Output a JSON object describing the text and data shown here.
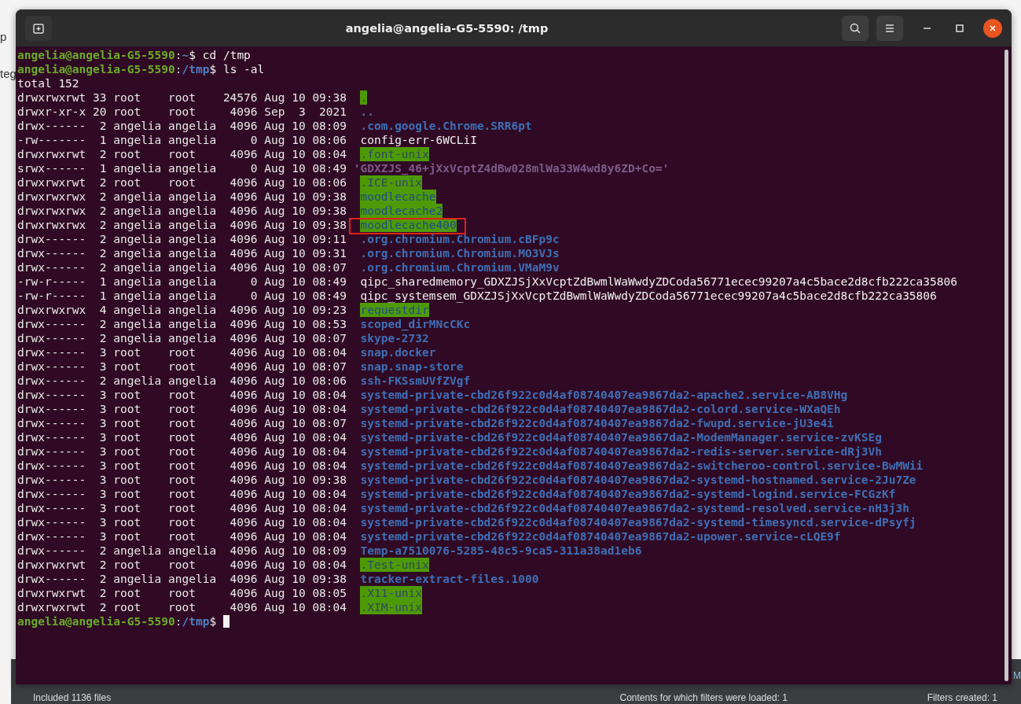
{
  "window": {
    "title": "angelia@angelia-G5-5590: /tmp"
  },
  "background": {
    "fragments": [
      "p",
      "teg"
    ],
    "status_items": [
      "Included 1136 files",
      "Contents for which filters were loaded: 1",
      "Filters created: 1"
    ],
    "edge_letter": "M"
  },
  "terminal": {
    "lines": [
      {
        "kind": "prompt",
        "user": "angelia@angelia-G5-5590",
        "sep": ":",
        "path": "~",
        "sign": "$",
        "command": " cd /tmp"
      },
      {
        "kind": "prompt",
        "user": "angelia@angelia-G5-5590",
        "sep": ":",
        "path": "/tmp",
        "sign": "$",
        "command": " ls -al"
      },
      {
        "kind": "text",
        "text": "total 152"
      },
      {
        "kind": "sticky_dir",
        "meta": "drwxrwxrwt 33 root    root    24576 Aug 10 09:38",
        "name": ".",
        "highlighted": false
      },
      {
        "kind": "dir",
        "meta": "drwxr-xr-x 20 root    root     4096 Sep  3  2021",
        "name": "..",
        "highlighted": false
      },
      {
        "kind": "dir",
        "meta": "drwx------  2 angelia angelia  4096 Aug 10 08:09",
        "name": ".com.google.Chrome.SRR6pt",
        "highlighted": false
      },
      {
        "kind": "file",
        "meta": "-rw-------  1 angelia angelia     0 Aug 10 08:06",
        "name": "config-err-6WCLiI",
        "highlighted": false
      },
      {
        "kind": "sticky_dir",
        "meta": "drwxrwxrwt  2 root    root     4096 Aug 10 08:04",
        "name": ".font-unix",
        "highlighted": false
      },
      {
        "kind": "socket",
        "meta": "srwx------  1 angelia angelia     0 Aug 10 08:49",
        "name": "'GDXZJS_46+jXxVcptZ4dBw028mlWa33W4wd8y6ZD+Co='",
        "highlighted": false
      },
      {
        "kind": "sticky_dir",
        "meta": "drwxrwxrwt  2 root    root     4096 Aug 10 08:06",
        "name": ".ICE-unix",
        "highlighted": false
      },
      {
        "kind": "writable_dir",
        "meta": "drwxrwxrwx  2 angelia angelia  4096 Aug 10 09:38",
        "name": "moodlecache",
        "highlighted": false
      },
      {
        "kind": "writable_dir",
        "meta": "drwxrwxrwx  2 angelia angelia  4096 Aug 10 09:38",
        "name": "moodlecache2",
        "highlighted": false
      },
      {
        "kind": "writable_dir",
        "meta": "drwxrwxrwx  2 angelia angelia  4096 Aug 10 09:38",
        "name": "moodlecache400",
        "highlighted": true
      },
      {
        "kind": "dir",
        "meta": "drwx------  2 angelia angelia  4096 Aug 10 09:11",
        "name": ".org.chromium.Chromium.cBFp9c",
        "highlighted": false
      },
      {
        "kind": "dir",
        "meta": "drwx------  2 angelia angelia  4096 Aug 10 09:31",
        "name": ".org.chromium.Chromium.MO3VJs",
        "highlighted": false
      },
      {
        "kind": "dir",
        "meta": "drwx------  2 angelia angelia  4096 Aug 10 08:07",
        "name": ".org.chromium.Chromium.VMaM9v",
        "highlighted": false
      },
      {
        "kind": "file",
        "meta": "-rw-r-----  1 angelia angelia     0 Aug 10 08:49",
        "name": "qipc_sharedmemory_GDXZJSjXxVcptZdBwmlWaWwdyZDCoda56771ecec99207a4c5bace2d8cfb222ca35806",
        "highlighted": false
      },
      {
        "kind": "file",
        "meta": "-rw-r-----  1 angelia angelia     0 Aug 10 08:49",
        "name": "qipc_systemsem_GDXZJSjXxVcptZdBwmlWaWwdyZDCoda56771ecec99207a4c5bace2d8cfb222ca35806",
        "highlighted": false
      },
      {
        "kind": "writable_dir",
        "meta": "drwxrwxrwx  4 angelia angelia  4096 Aug 10 09:23",
        "name": "requestdir",
        "highlighted": false
      },
      {
        "kind": "dir",
        "meta": "drwx------  2 angelia angelia  4096 Aug 10 08:53",
        "name": "scoped_dirMNcCKc",
        "highlighted": false
      },
      {
        "kind": "dir",
        "meta": "drwx------  2 angelia angelia  4096 Aug 10 08:07",
        "name": "skype-2732",
        "highlighted": false
      },
      {
        "kind": "dir",
        "meta": "drwx------  3 root    root     4096 Aug 10 08:04",
        "name": "snap.docker",
        "highlighted": false
      },
      {
        "kind": "dir",
        "meta": "drwx------  3 root    root     4096 Aug 10 08:07",
        "name": "snap.snap-store",
        "highlighted": false
      },
      {
        "kind": "dir",
        "meta": "drwx------  2 angelia angelia  4096 Aug 10 08:06",
        "name": "ssh-FKSsmUVfZVgf",
        "highlighted": false
      },
      {
        "kind": "dir",
        "meta": "drwx------  3 root    root     4096 Aug 10 08:04",
        "name": "systemd-private-cbd26f922c0d4af08740407ea9867da2-apache2.service-AB8VHg",
        "highlighted": false
      },
      {
        "kind": "dir",
        "meta": "drwx------  3 root    root     4096 Aug 10 08:04",
        "name": "systemd-private-cbd26f922c0d4af08740407ea9867da2-colord.service-WXaQEh",
        "highlighted": false
      },
      {
        "kind": "dir",
        "meta": "drwx------  3 root    root     4096 Aug 10 08:07",
        "name": "systemd-private-cbd26f922c0d4af08740407ea9867da2-fwupd.service-jU3e4i",
        "highlighted": false
      },
      {
        "kind": "dir",
        "meta": "drwx------  3 root    root     4096 Aug 10 08:04",
        "name": "systemd-private-cbd26f922c0d4af08740407ea9867da2-ModemManager.service-zvKSEg",
        "highlighted": false
      },
      {
        "kind": "dir",
        "meta": "drwx------  3 root    root     4096 Aug 10 08:04",
        "name": "systemd-private-cbd26f922c0d4af08740407ea9867da2-redis-server.service-dRj3Vh",
        "highlighted": false
      },
      {
        "kind": "dir",
        "meta": "drwx------  3 root    root     4096 Aug 10 08:04",
        "name": "systemd-private-cbd26f922c0d4af08740407ea9867da2-switcheroo-control.service-BwMWii",
        "highlighted": false
      },
      {
        "kind": "dir",
        "meta": "drwx------  3 root    root     4096 Aug 10 09:38",
        "name": "systemd-private-cbd26f922c0d4af08740407ea9867da2-systemd-hostnamed.service-2Ju7Ze",
        "highlighted": false
      },
      {
        "kind": "dir",
        "meta": "drwx------  3 root    root     4096 Aug 10 08:04",
        "name": "systemd-private-cbd26f922c0d4af08740407ea9867da2-systemd-logind.service-FCGzKf",
        "highlighted": false
      },
      {
        "kind": "dir",
        "meta": "drwx------  3 root    root     4096 Aug 10 08:04",
        "name": "systemd-private-cbd26f922c0d4af08740407ea9867da2-systemd-resolved.service-nH3j3h",
        "highlighted": false
      },
      {
        "kind": "dir",
        "meta": "drwx------  3 root    root     4096 Aug 10 08:04",
        "name": "systemd-private-cbd26f922c0d4af08740407ea9867da2-systemd-timesyncd.service-dPsyfj",
        "highlighted": false
      },
      {
        "kind": "dir",
        "meta": "drwx------  3 root    root     4096 Aug 10 08:04",
        "name": "systemd-private-cbd26f922c0d4af08740407ea9867da2-upower.service-cLQE9f",
        "highlighted": false
      },
      {
        "kind": "dir",
        "meta": "drwx------  2 angelia angelia  4096 Aug 10 08:09",
        "name": "Temp-a7510076-5285-48c5-9ca5-311a38ad1eb6",
        "highlighted": false
      },
      {
        "kind": "sticky_dir",
        "meta": "drwxrwxrwt  2 root    root     4096 Aug 10 08:04",
        "name": ".Test-unix",
        "highlighted": false
      },
      {
        "kind": "dir",
        "meta": "drwx------  2 angelia angelia  4096 Aug 10 09:38",
        "name": "tracker-extract-files.1000",
        "highlighted": false
      },
      {
        "kind": "sticky_dir",
        "meta": "drwxrwxrwt  2 root    root     4096 Aug 10 08:05",
        "name": ".X11-unix",
        "highlighted": false
      },
      {
        "kind": "sticky_dir",
        "meta": "drwxrwxrwt  2 root    root     4096 Aug 10 08:04",
        "name": ".XIM-unix",
        "highlighted": false
      },
      {
        "kind": "prompt",
        "user": "angelia@angelia-G5-5590",
        "sep": ":",
        "path": "/tmp",
        "sign": "$",
        "cursor": true
      }
    ]
  }
}
